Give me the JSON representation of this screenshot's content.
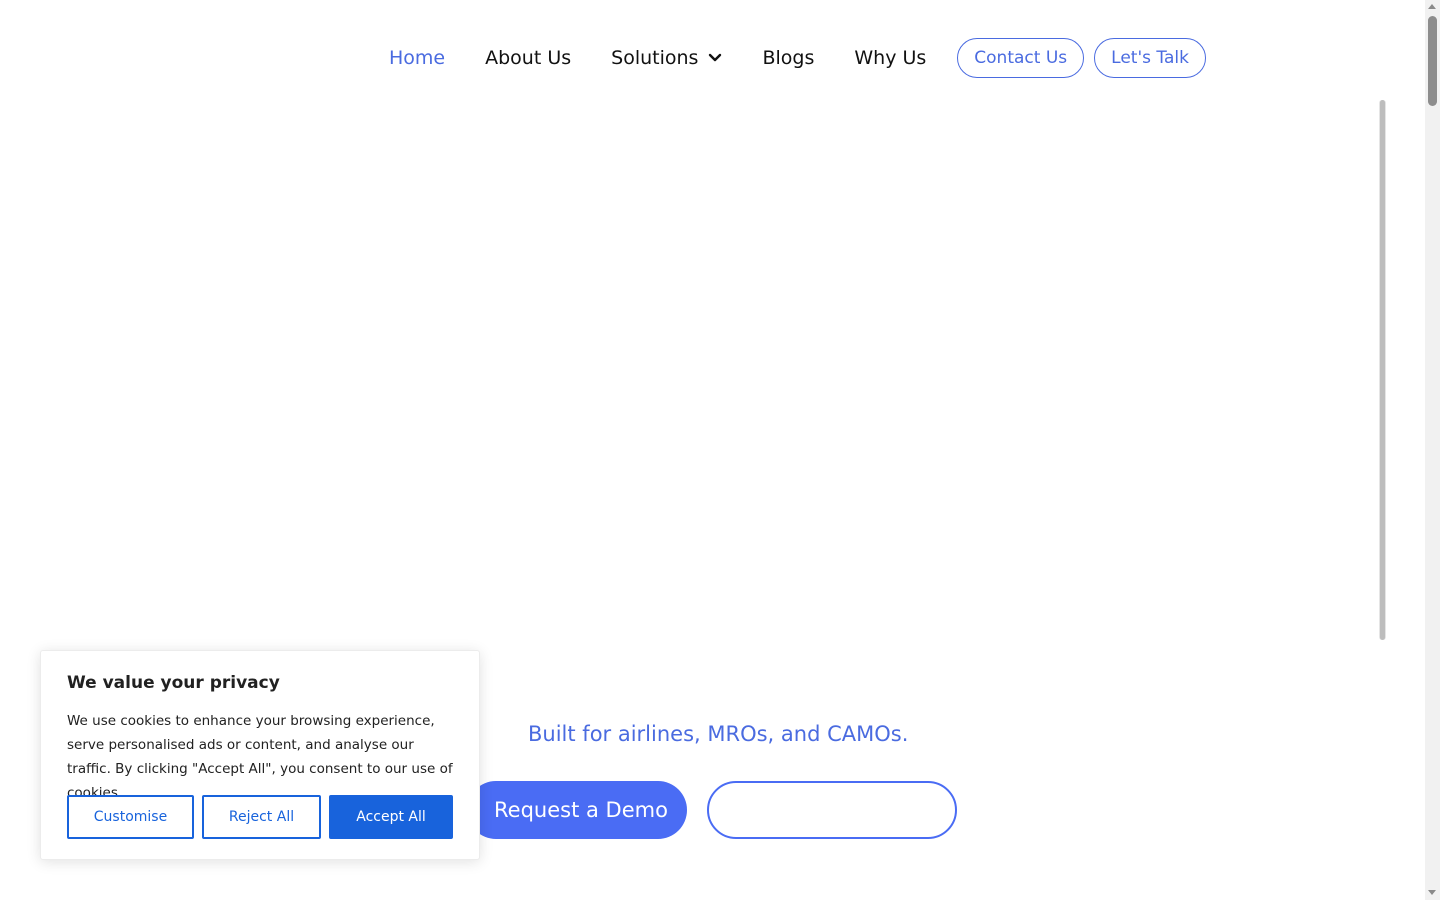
{
  "nav": {
    "items": [
      {
        "label": "Home",
        "active": true
      },
      {
        "label": "About Us"
      },
      {
        "label": "Solutions",
        "icon": "chevron-down-icon"
      },
      {
        "label": "Blogs"
      },
      {
        "label": "Why Us"
      }
    ],
    "contact_label": "Contact Us",
    "talk_label": "Let's Talk"
  },
  "hero": {
    "tagline": "Built for airlines, MROs, and CAMOs.",
    "demo_label": "Request a Demo",
    "secondary_label": ""
  },
  "cookie": {
    "title": "We value your privacy",
    "body": "We use cookies to enhance your browsing experience, serve personalised ads or content, and analyse our traffic. By clicking \"Accept All\", you consent to our use of cookies.",
    "customise_label": "Customise",
    "reject_label": "Reject All",
    "accept_label": "Accept All"
  },
  "colors": {
    "accent": "#4a6be0",
    "button": "#4a6cf4",
    "cookie_accent": "#1863dc"
  }
}
